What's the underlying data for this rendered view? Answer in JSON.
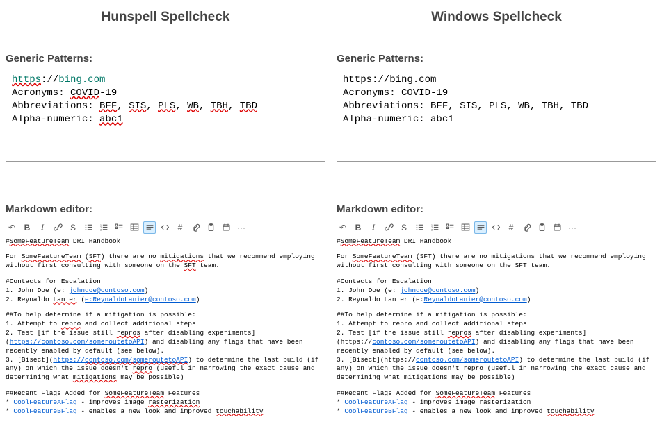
{
  "columns": {
    "left": {
      "title": "Hunspell Spellcheck"
    },
    "right": {
      "title": "Windows Spellcheck"
    }
  },
  "generic_patterns": {
    "heading": "Generic Patterns:",
    "url_scheme": "https",
    "url_delim": "://",
    "url_host": "bing.com",
    "acronyms_label": "Acronyms: ",
    "acronym_word": "COVID",
    "acronym_suffix": "-19",
    "abbrev_label": "Abbreviations: ",
    "abbrev_items": [
      "BFF",
      "SIS",
      "PLS",
      "WB",
      "TBH",
      "TBD"
    ],
    "abbrev_sep": ", ",
    "alnum_label": "Alpha-numeric: ",
    "alnum_value": "abc1"
  },
  "markdown_heading": "Markdown editor:",
  "toolbar": {
    "undo": "↶",
    "bold": "B",
    "italic": "I",
    "strike": "S",
    "hash": "#",
    "more": "···"
  },
  "md": {
    "t_hash": "#",
    "t_SomeFeatureTeam": "SomeFeatureTeam",
    "t_sp": " ",
    "t_DRI_Handbook": "DRI Handbook",
    "p_for": "For ",
    "p_open": " (",
    "p_SFT": "SFT",
    "p_close_there": ") there are no ",
    "p_mitigations": "mitigations",
    "p_rec": " that we recommend employing without first consulting with someone on the ",
    "p_team": " team.",
    "c_head": "#Contacts for Escalation",
    "c_l1a": "1. John Doe (e: ",
    "c_email1": "johndoe@contoso.com",
    "c_l1b": ")",
    "c_l2a": "2. Reynaldo ",
    "c_Lanier": "Lanier",
    "c_l2b_left": " (",
    "c_l2b_right": " (e:",
    "c_e_prefix": "e:",
    "c_email2": "ReynaldoLanier@contoso.com",
    "c_l2c": ")",
    "h_head": "##To help determine if a mitigation is possible:",
    "h_l1a": "1. Attempt to ",
    "h_repro": "repro",
    "h_l1b": " and collect additional steps",
    "h_l1_all": "1. Attempt to repro and collect additional steps",
    "h_l2a": "2. Test [if the issue still ",
    "h_repros": "repros",
    "h_l2b_left": " after disabling experiments](",
    "h_l2b_right_a": " after disabling experiments](https://",
    "h_api": "contoso.com/someroutetoAPI",
    "h_l2c": ") and disabling any flags that have been recently enabled by default (see below).",
    "h_l2c_right": ") and disabling any flags that have been recently enabled by default (see below).",
    "h_l3a": "3. [Bisect](",
    "h_bisect_url_left": "https://",
    "h_bisect_url_right": "https://",
    "h_bisect_host": "contoso.com/someroutetoAPI",
    "h_l3b": ") to determine the last build (if any) on which the issue doesn't ",
    "h_l3c_left": " (useful in narrowing the exact cause and determining what ",
    "h_l3c_right": " (useful in narrowing the exact cause and determining what mitigations may be possible)",
    "h_l3d": " may be possible)",
    "f_head_a": "##Recent Flags Added for ",
    "f_head_b": " Features",
    "f_l1a": "* ",
    "f_CoolA": "CoolFeatureAFlag",
    "f_l1b": " - improves image ",
    "f_raster": "rasterization",
    "f_l1_all_right": " - improves image rasterization",
    "f_l2a": "* ",
    "f_CoolB": "CoolFeatureBFlag",
    "f_l2b": " - enables a new look and improved ",
    "f_touch": "touchability"
  }
}
